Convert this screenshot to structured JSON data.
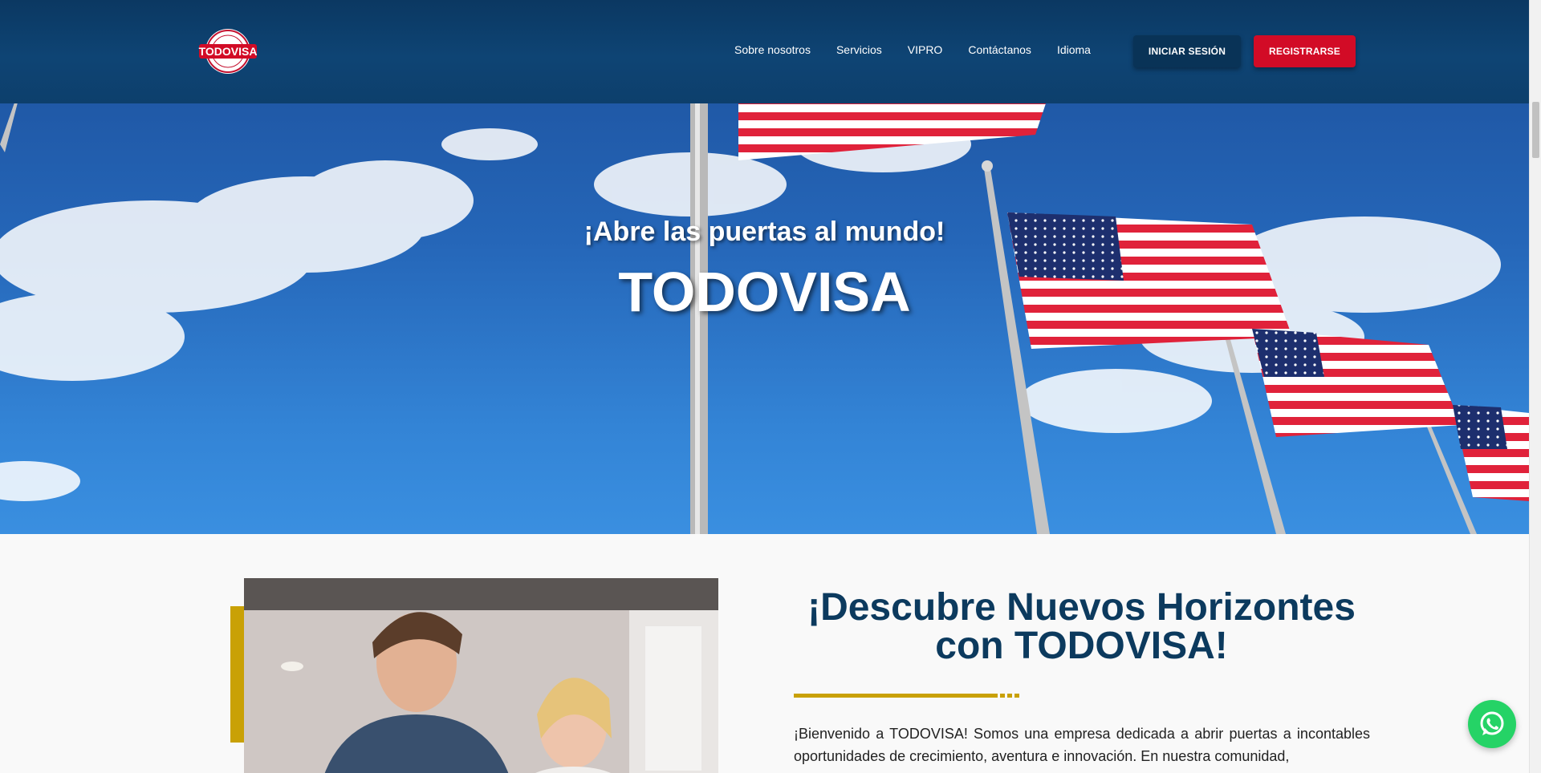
{
  "header": {
    "logo_text": "TODOVISA",
    "nav": [
      {
        "label": "Sobre nosotros"
      },
      {
        "label": "Servicios"
      },
      {
        "label": "VIPRO"
      },
      {
        "label": "Contáctanos"
      },
      {
        "label": "Idioma"
      }
    ],
    "login_label": "INICIAR SESIÓN",
    "register_label": "REGISTRARSE"
  },
  "hero": {
    "subtitle": "¡Abre las puertas al mundo!",
    "title": "TODOVISA"
  },
  "about": {
    "title": "¡Descubre Nuevos Horizontes con TODOVISA!",
    "intro": "¡Bienvenido a TODOVISA! Somos una empresa dedicada a abrir puertas a incontables oportunidades de crecimiento, aventura e innovación. En nuestra comunidad,"
  },
  "colors": {
    "header_bg": "#0e4474",
    "brand_red": "#d20b26",
    "navy": "#0c3a5e",
    "gold": "#c9a106",
    "whatsapp": "#25d366"
  },
  "icons": {
    "whatsapp": "whatsapp-icon",
    "logo": "todovisa-logo"
  }
}
